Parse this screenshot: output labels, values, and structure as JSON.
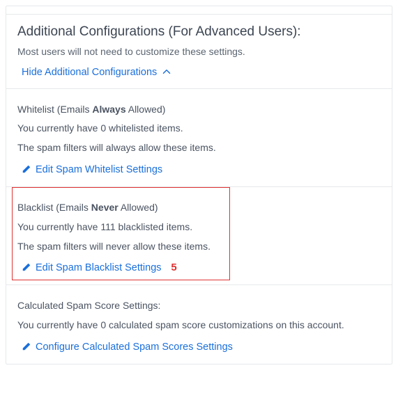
{
  "header": {
    "title": "Additional Configurations (For Advanced Users):",
    "subtitle": "Most users will not need to customize these settings.",
    "toggle_label": "Hide Additional Configurations"
  },
  "whitelist": {
    "title_pre": "Whitelist (Emails ",
    "title_strong": "Always",
    "title_post": " Allowed)",
    "count_line": "You currently have 0 whitelisted items.",
    "desc": "The spam filters will always allow these items.",
    "link": "Edit Spam Whitelist Settings"
  },
  "blacklist": {
    "title_pre": "Blacklist (Emails ",
    "title_strong": "Never",
    "title_post": " Allowed)",
    "count_line": "You currently have 111 blacklisted items.",
    "desc": "The spam filters will never allow these items.",
    "link": "Edit Spam Blacklist Settings",
    "callout": "5"
  },
  "score": {
    "title": "Calculated Spam Score Settings:",
    "count_line": "You currently have 0 calculated spam score customizations on this account.",
    "link": "Configure Calculated Spam Scores Settings"
  }
}
